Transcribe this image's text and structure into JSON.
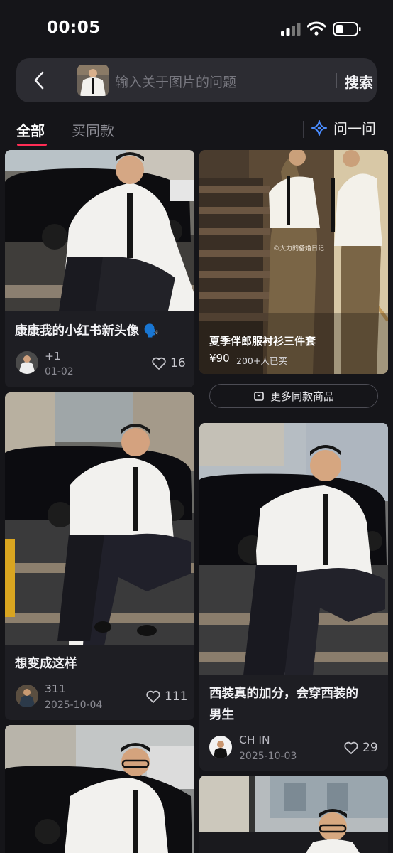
{
  "status": {
    "time": "00:05"
  },
  "search": {
    "placeholder": "输入关于图片的问题",
    "button": "搜索"
  },
  "tabs": {
    "all": "全部",
    "buy_same": "买同款",
    "ask": "问一问"
  },
  "feed": {
    "left": [
      {
        "title": "康康我的小红书新头像 🗣️",
        "author": "+1",
        "date": "01-02",
        "likes": "16"
      },
      {
        "title": "想变成这样",
        "author": "311",
        "date": "2025-10-04",
        "likes": "111"
      }
    ],
    "product": {
      "title": "夏季伴郎服衬衫三件套",
      "price": "¥90",
      "sold": "200+人已买",
      "watermark": "©大力的备婚日记",
      "more_button": "更多同款商品"
    },
    "right": [
      {
        "title_line1": "西装真的加分，会穿西装的",
        "title_line2": "男生",
        "author": "CH IN",
        "date": "2025-10-03",
        "likes": "29"
      }
    ]
  },
  "colors": {
    "accent": "#ff2d55",
    "ask_icon": "#4a8cff",
    "background": "#151519",
    "card": "#1e1e23"
  },
  "icons": [
    "back-arrow-icon",
    "star-ai-icon",
    "heart-icon",
    "bag-icon",
    "signal-icon",
    "wifi-icon",
    "battery-icon"
  ]
}
